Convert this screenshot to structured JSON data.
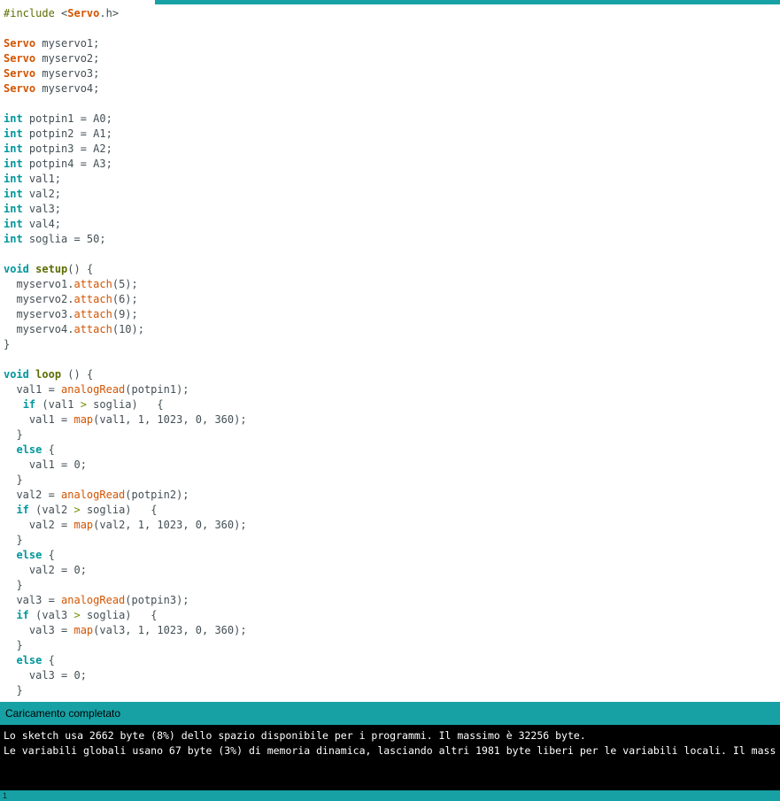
{
  "colors": {
    "teal_bar": "#17A1A5",
    "editor_bg": "#FFFFFF",
    "console_bg": "#000000",
    "console_text": "#FFFFFF",
    "token": {
      "p": "#434F54",
      "inc": "#5E6D03",
      "cls": "#D35400",
      "kw": "#00979C",
      "fn": "#D35400",
      "st": "#5E6D03",
      "op": "#728E00"
    }
  },
  "editor": {
    "bold_tokens": [
      "cls",
      "kw",
      "st"
    ],
    "lines": [
      [
        [
          "inc",
          "#include"
        ],
        [
          "p",
          " <"
        ],
        [
          "cls",
          "Servo"
        ],
        [
          "p",
          ".h>"
        ]
      ],
      [],
      [
        [
          "cls",
          "Servo"
        ],
        [
          "p",
          " myservo1;"
        ]
      ],
      [
        [
          "cls",
          "Servo"
        ],
        [
          "p",
          " myservo2;"
        ]
      ],
      [
        [
          "cls",
          "Servo"
        ],
        [
          "p",
          " myservo3;"
        ]
      ],
      [
        [
          "cls",
          "Servo"
        ],
        [
          "p",
          " myservo4;"
        ]
      ],
      [],
      [
        [
          "kw",
          "int"
        ],
        [
          "p",
          " potpin1 = A0;"
        ]
      ],
      [
        [
          "kw",
          "int"
        ],
        [
          "p",
          " potpin2 = A1;"
        ]
      ],
      [
        [
          "kw",
          "int"
        ],
        [
          "p",
          " potpin3 = A2;"
        ]
      ],
      [
        [
          "kw",
          "int"
        ],
        [
          "p",
          " potpin4 = A3;"
        ]
      ],
      [
        [
          "kw",
          "int"
        ],
        [
          "p",
          " val1;"
        ]
      ],
      [
        [
          "kw",
          "int"
        ],
        [
          "p",
          " val2;"
        ]
      ],
      [
        [
          "kw",
          "int"
        ],
        [
          "p",
          " val3;"
        ]
      ],
      [
        [
          "kw",
          "int"
        ],
        [
          "p",
          " val4;"
        ]
      ],
      [
        [
          "kw",
          "int"
        ],
        [
          "p",
          " soglia = 50;"
        ]
      ],
      [],
      [
        [
          "kw",
          "void"
        ],
        [
          "p",
          " "
        ],
        [
          "st",
          "setup"
        ],
        [
          "p",
          "() {"
        ]
      ],
      [
        [
          "p",
          "  myservo1."
        ],
        [
          "fn",
          "attach"
        ],
        [
          "p",
          "(5);"
        ]
      ],
      [
        [
          "p",
          "  myservo2."
        ],
        [
          "fn",
          "attach"
        ],
        [
          "p",
          "(6);"
        ]
      ],
      [
        [
          "p",
          "  myservo3."
        ],
        [
          "fn",
          "attach"
        ],
        [
          "p",
          "(9);"
        ]
      ],
      [
        [
          "p",
          "  myservo4."
        ],
        [
          "fn",
          "attach"
        ],
        [
          "p",
          "(10);"
        ]
      ],
      [
        [
          "p",
          "}"
        ]
      ],
      [],
      [
        [
          "kw",
          "void"
        ],
        [
          "p",
          " "
        ],
        [
          "st",
          "loop"
        ],
        [
          "p",
          " () {"
        ]
      ],
      [
        [
          "p",
          "  val1 = "
        ],
        [
          "fn",
          "analogRead"
        ],
        [
          "p",
          "(potpin1);"
        ]
      ],
      [
        [
          "p",
          "   "
        ],
        [
          "kw",
          "if"
        ],
        [
          "p",
          " (val1 "
        ],
        [
          "op",
          ">"
        ],
        [
          "p",
          " soglia)   {"
        ]
      ],
      [
        [
          "p",
          "    val1 = "
        ],
        [
          "fn",
          "map"
        ],
        [
          "p",
          "(val1, 1, 1023, 0, 360);"
        ]
      ],
      [
        [
          "p",
          "  }"
        ]
      ],
      [
        [
          "p",
          "  "
        ],
        [
          "kw",
          "else"
        ],
        [
          "p",
          " {"
        ]
      ],
      [
        [
          "p",
          "    val1 = 0;"
        ]
      ],
      [
        [
          "p",
          "  }"
        ]
      ],
      [
        [
          "p",
          "  val2 = "
        ],
        [
          "fn",
          "analogRead"
        ],
        [
          "p",
          "(potpin2);"
        ]
      ],
      [
        [
          "p",
          "  "
        ],
        [
          "kw",
          "if"
        ],
        [
          "p",
          " (val2 "
        ],
        [
          "op",
          ">"
        ],
        [
          "p",
          " soglia)   {"
        ]
      ],
      [
        [
          "p",
          "    val2 = "
        ],
        [
          "fn",
          "map"
        ],
        [
          "p",
          "(val2, 1, 1023, 0, 360);"
        ]
      ],
      [
        [
          "p",
          "  }"
        ]
      ],
      [
        [
          "p",
          "  "
        ],
        [
          "kw",
          "else"
        ],
        [
          "p",
          " {"
        ]
      ],
      [
        [
          "p",
          "    val2 = 0;"
        ]
      ],
      [
        [
          "p",
          "  }"
        ]
      ],
      [
        [
          "p",
          "  val3 = "
        ],
        [
          "fn",
          "analogRead"
        ],
        [
          "p",
          "(potpin3);"
        ]
      ],
      [
        [
          "p",
          "  "
        ],
        [
          "kw",
          "if"
        ],
        [
          "p",
          " (val3 "
        ],
        [
          "op",
          ">"
        ],
        [
          "p",
          " soglia)   {"
        ]
      ],
      [
        [
          "p",
          "    val3 = "
        ],
        [
          "fn",
          "map"
        ],
        [
          "p",
          "(val3, 1, 1023, 0, 360);"
        ]
      ],
      [
        [
          "p",
          "  }"
        ]
      ],
      [
        [
          "p",
          "  "
        ],
        [
          "kw",
          "else"
        ],
        [
          "p",
          " {"
        ]
      ],
      [
        [
          "p",
          "    val3 = 0;"
        ]
      ],
      [
        [
          "p",
          "  }"
        ]
      ]
    ]
  },
  "status_bar": {
    "text": "Caricamento completato"
  },
  "console": {
    "lines": [
      "Lo sketch usa 2662 byte (8%) dello spazio disponibile per i programmi. Il massimo è 32256 byte.",
      "Le variabili globali usano 67 byte (3%) di memoria dinamica, lasciando altri 1981 byte liberi per le variabili locali. Il mass"
    ]
  },
  "footer": {
    "line_number": "1"
  }
}
